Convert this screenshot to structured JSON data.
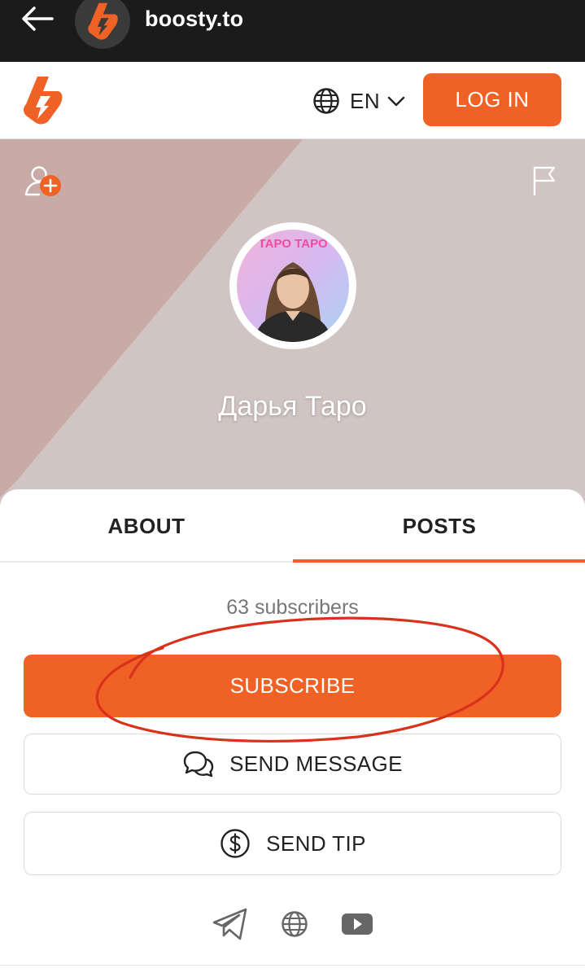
{
  "browser": {
    "url": "boosty.to"
  },
  "header": {
    "language": "EN",
    "login_label": "LOG IN"
  },
  "profile": {
    "name": "Дарья Таро",
    "avatar_caption": "ТАРО ТАРО"
  },
  "tabs": [
    {
      "label": "ABOUT",
      "active": false
    },
    {
      "label": "POSTS",
      "active": true
    }
  ],
  "stats": {
    "subscribers": "63 subscribers"
  },
  "actions": {
    "subscribe_label": "SUBSCRIBE",
    "message_label": "SEND MESSAGE",
    "tip_label": "SEND TIP"
  },
  "socials": [
    "telegram-icon",
    "globe-icon",
    "youtube-icon"
  ],
  "colors": {
    "accent": "#f06125",
    "cover_bg": "#d1c5c3",
    "cover_diag": "#c8aba7",
    "annotation": "#d8321d"
  }
}
